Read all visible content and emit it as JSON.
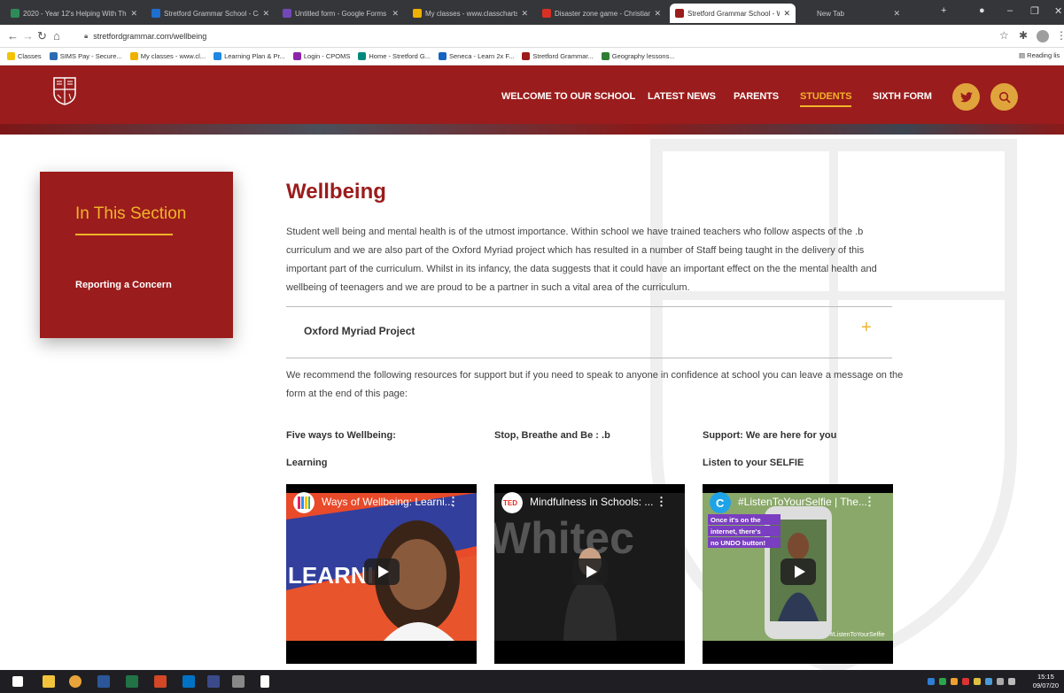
{
  "browser": {
    "tabs": [
      {
        "label": "2020 - Year 12's Helping With Th",
        "color": "#2e8b57"
      },
      {
        "label": "Stretford Grammar School - Cale",
        "color": "#1e6fd0"
      },
      {
        "label": "Untitled form - Google Forms",
        "color": "#7248b9"
      },
      {
        "label": "My classes - www.classcharts.co",
        "color": "#f0b000"
      },
      {
        "label": "Disaster zone game - Christian A",
        "color": "#d93025"
      },
      {
        "label": "Stretford Grammar School - We",
        "color": "#9b1c1c"
      },
      {
        "label": "New Tab",
        "color": "#35363a"
      }
    ],
    "url": "stretfordgrammar.com/wellbeing",
    "bookmarks": [
      {
        "label": "Classes",
        "color": "#f2c300"
      },
      {
        "label": "SIMS Pay - Secure...",
        "color": "#2b6cb0"
      },
      {
        "label": "My classes - www.cl...",
        "color": "#f0b000"
      },
      {
        "label": "Learning Plan & Pr...",
        "color": "#1e88e5"
      },
      {
        "label": "Login - CPOMS",
        "color": "#8e24aa"
      },
      {
        "label": "Home - Stretford G...",
        "color": "#00897b"
      },
      {
        "label": "Seneca - Learn 2x F...",
        "color": "#1565c0"
      },
      {
        "label": "Stretford Grammar...",
        "color": "#9b1c1c"
      },
      {
        "label": "Geography lessons...",
        "color": "#2e7d32"
      }
    ],
    "reading_list": "Reading lis"
  },
  "site": {
    "brand_color": "#9b1c1c",
    "accent_color": "#f0b42a",
    "nav": [
      {
        "label": "WELCOME TO OUR SCHOOL",
        "active": false
      },
      {
        "label": "LATEST NEWS",
        "active": false
      },
      {
        "label": "PARENTS",
        "active": false
      },
      {
        "label": "STUDENTS",
        "active": true
      },
      {
        "label": "SIXTH FORM",
        "active": false
      }
    ],
    "sidebar": {
      "title": "In This Section",
      "links": [
        "Reporting a Concern"
      ]
    },
    "page_title": "Wellbeing",
    "intro": "Student well being and mental health is of the utmost importance. Within school we have trained teachers who follow aspects of the .b curriculum and we are also part of the Oxford Myriad project which has resulted in a number of Staff being taught in the delivery of this important part of the curriculum.  Whilst in its infancy, the data suggests that it could have an important effect on the the mental health and wellbeing of teenagers and we are proud to be a partner in such a vital area of the curriculum.",
    "accordion": {
      "label": "Oxford Myriad Project",
      "toggle": "+"
    },
    "recommend": "We recommend the following resources for support but if you need to speak to anyone in confidence at school you can leave a message on the form at the end of this page:",
    "resources": [
      {
        "heading": "Five ways to Wellbeing:",
        "subheading": "Learning",
        "video_title": "Ways of Wellbeing: Learni...",
        "thumb_text": "LEARNI"
      },
      {
        "heading": "Stop, Breathe and Be : .b",
        "subheading": "",
        "video_title": "Mindfulness in Schools: ...",
        "thumb_text": "Whitec"
      },
      {
        "heading": "Support: We are here for you",
        "subheading": "Listen to your SELFIE",
        "video_title": "#ListenToYourSelfie | The...",
        "thumb_text": "Once it's on the internet, there's no UNDO button!",
        "thumb_tag": "#ListenToYourSelfie"
      }
    ]
  },
  "taskbar": {
    "time": "15:15",
    "date": "09/07/20"
  }
}
